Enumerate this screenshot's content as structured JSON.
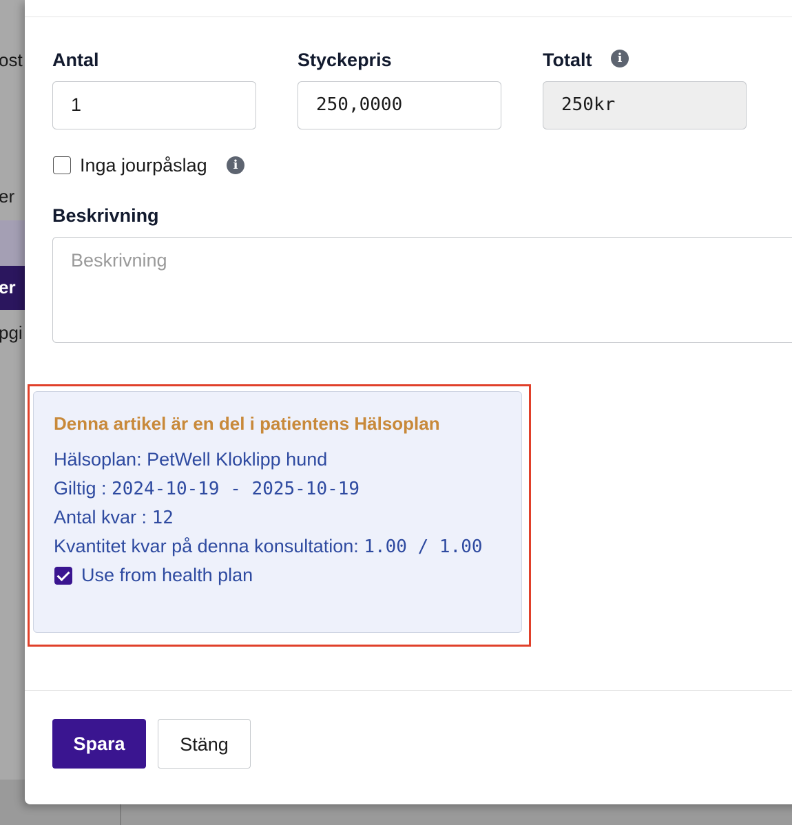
{
  "background": {
    "fragments": [
      "ost",
      "er",
      "pgi"
    ],
    "active_nav": "er"
  },
  "form": {
    "antal": {
      "label": "Antal",
      "value": "1"
    },
    "styckepris": {
      "label": "Styckepris",
      "value": "250,0000"
    },
    "totalt": {
      "label": "Totalt",
      "value": "250kr"
    },
    "no_oncall_surcharge": {
      "label": "Inga jourpåslag",
      "checked": false
    },
    "beskrivning": {
      "label": "Beskrivning",
      "placeholder": "Beskrivning",
      "value": ""
    }
  },
  "health_plan": {
    "title": "Denna artikel är en del i patientens Hälsoplan",
    "plan": {
      "label": "Hälsoplan:",
      "value": "PetWell Kloklipp hund"
    },
    "valid": {
      "label": "Giltig :",
      "value": "2024-10-19 - 2025-10-19"
    },
    "remaining": {
      "label": "Antal kvar :",
      "value": "12"
    },
    "consultation_remaining": {
      "label": "Kvantitet kvar på denna konsultation:",
      "value": "1.00 / 1.00"
    },
    "use_from_plan": {
      "label": "Use from health plan",
      "checked": true
    }
  },
  "footer": {
    "save_label": "Spara",
    "close_label": "Stäng"
  },
  "colors": {
    "primary": "#3a1590",
    "highlight_outline": "#e0402a",
    "health_plan_title": "#c8893a",
    "health_plan_text": "#2e4aa0"
  }
}
